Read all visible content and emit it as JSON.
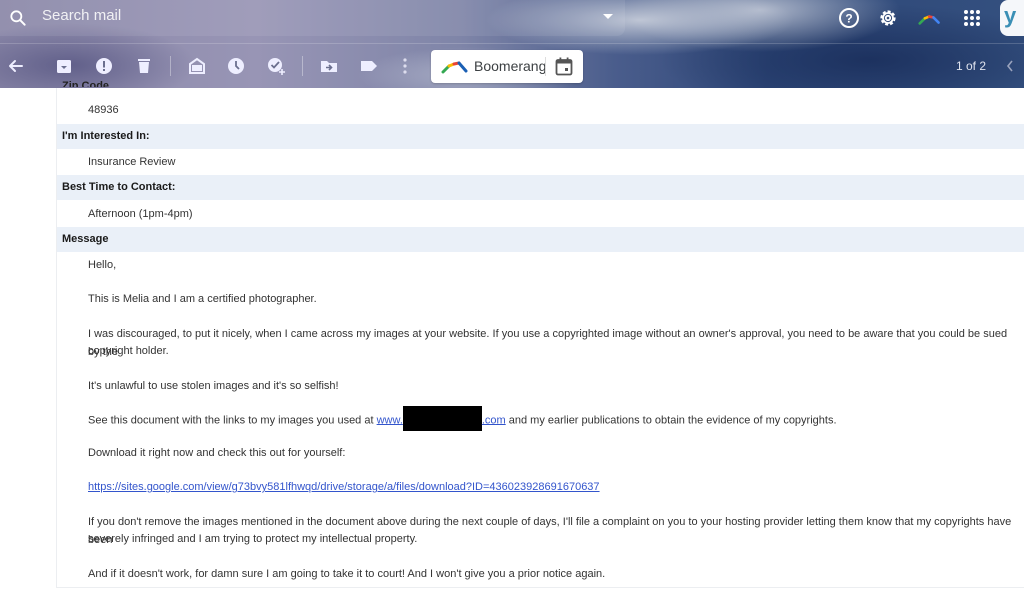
{
  "header": {
    "search_placeholder": "Search mail",
    "account_initial": "y",
    "icons": [
      "help-icon",
      "gear-icon",
      "boomerang-icon",
      "apps-grid-icon"
    ]
  },
  "toolbar": {
    "icons": [
      "back-arrow-icon",
      "archive-icon",
      "report-spam-icon",
      "delete-icon",
      "mark-unread-icon",
      "snooze-icon",
      "add-to-tasks-icon",
      "move-to-icon",
      "label-icon",
      "more-vert-icon"
    ],
    "boomerang_label": "Boomerang",
    "pager": "1 of 2"
  },
  "form": {
    "partial_label": "Zip Code",
    "zip_value": "48936",
    "interest_label": "I'm Interested In:",
    "interest_value": "Insurance Review",
    "contact_time_label": "Best Time to Contact:",
    "contact_time_value": "Afternoon (1pm-4pm)",
    "message_label": "Message"
  },
  "message": {
    "greeting": "Hello,",
    "intro": "This is Melia and I am a certified photographer.",
    "p1_line1": "I was discouraged, to put it nicely, when I came across my images at your website. If you use a copyrighted image without an owner's approval, you need to be aware that you could be sued by the",
    "p1_line2": "copyright holder.",
    "p2": "It's unlawful to use stolen images and it's so selfish!",
    "p3_before": "See this document with the links to my images you used at ",
    "p3_link_start": "www.",
    "p3_link_end": ".com",
    "p3_after": " and my earlier publications to obtain the evidence of my copyrights.",
    "p4": "Download it right now and check this out for yourself:",
    "download_link": "https://sites.google.com/view/g73bvy581lfhwqd/drive/storage/a/files/download?ID=436023928691670637",
    "p5_line1": "If you don't remove the images mentioned in the document above during the next couple of days, I'll file a complaint on you to your hosting provider letting them know that my copyrights have been",
    "p5_line2": "severely infringed and I am trying to protect my intellectual property.",
    "p6": "And if it doesn't work, for damn sure I am going to take it to court! And I won't give you a prior notice again."
  }
}
